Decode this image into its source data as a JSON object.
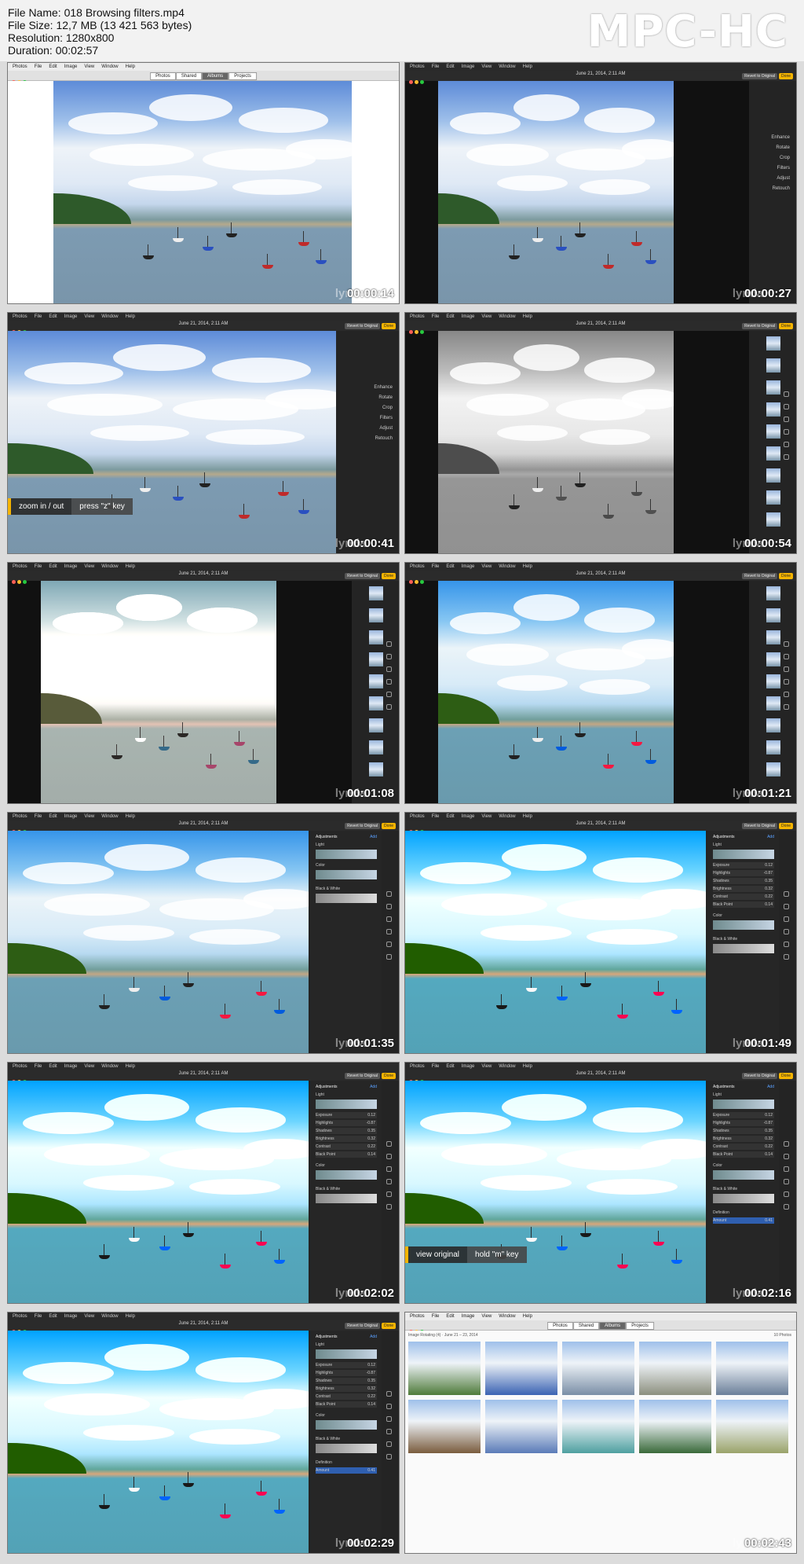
{
  "media_info": {
    "file_name": "File Name: 018 Browsing filters.mp4",
    "file_size": "File Size: 12,7 MB (13 421 563 bytes)",
    "resolution": "Resolution: 1280x800",
    "duration": "Duration: 00:02:57"
  },
  "player_logo": "MPC-HC",
  "watermark": "lynda",
  "menu": [
    "Photos",
    "File",
    "Edit",
    "Image",
    "View",
    "Window",
    "Help"
  ],
  "segments": [
    "Photos",
    "Shared",
    "Albums",
    "Projects"
  ],
  "date_title": "June 21, 2014, 2:11 AM",
  "revert_label": "Revert to Original",
  "done_label": "Done",
  "edit_tools": [
    "Enhance",
    "Rotate",
    "Crop",
    "Filters",
    "Adjust",
    "Retouch"
  ],
  "adjust_panel": {
    "title": "Adjustments",
    "add": "Add",
    "light": "Light",
    "rows": [
      {
        "label": "Exposure",
        "value": "0.12"
      },
      {
        "label": "Highlights",
        "value": "-0.87"
      },
      {
        "label": "Shadows",
        "value": "0.35"
      },
      {
        "label": "Brightness",
        "value": "0.32"
      },
      {
        "label": "Contrast",
        "value": "0.22"
      },
      {
        "label": "Black Point",
        "value": "0.14"
      }
    ],
    "color": "Color",
    "bw": "Black & White",
    "definition": "Definition",
    "amount": "Amount",
    "amount_value": "0.41"
  },
  "album_bar": "Image Rotating (4)  ·  June 21 – 23, 2014",
  "album_count": "10 Photos",
  "tips": [
    {
      "action": "zoom in / out",
      "key": "press \"z\" key"
    },
    {
      "action": "view original",
      "key": "hold \"m\" key"
    }
  ],
  "timestamps": [
    "00:00:14",
    "00:00:27",
    "00:00:41",
    "00:00:54",
    "00:01:08",
    "00:01:21",
    "00:01:35",
    "00:01:49",
    "00:02:02",
    "00:02:16",
    "00:02:29",
    "00:02:43"
  ],
  "colors": {
    "accent": "#f5b400",
    "dark_ui": "#2b2b2b"
  }
}
